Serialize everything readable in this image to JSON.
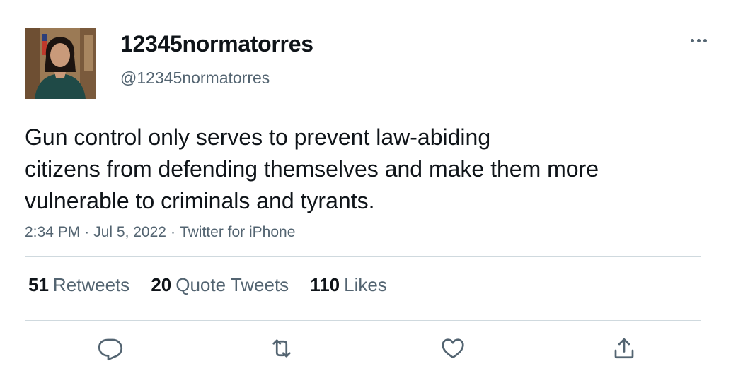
{
  "tweet": {
    "display_name": "12345normatorres",
    "handle": "@12345normatorres",
    "text_lines": [
      "Gun control only serves to prevent law-abiding",
      "citizens from defending themselves and make them more",
      "vulnerable to criminals and tyrants."
    ],
    "time": "2:34 PM",
    "date": "Jul 5, 2022",
    "source": "Twitter for iPhone",
    "separator": "·"
  },
  "stats": {
    "retweets": {
      "count": "51",
      "label": "Retweets"
    },
    "quote_tweets": {
      "count": "20",
      "label": "Quote Tweets"
    },
    "likes": {
      "count": "110",
      "label": "Likes"
    }
  },
  "icons": {
    "more": "more-options-icon",
    "reply": "reply-icon",
    "retweet": "retweet-icon",
    "like": "heart-icon",
    "share": "share-icon"
  },
  "colors": {
    "text": "#0f1419",
    "secondary": "#536471",
    "divider": "#cfd9de"
  }
}
